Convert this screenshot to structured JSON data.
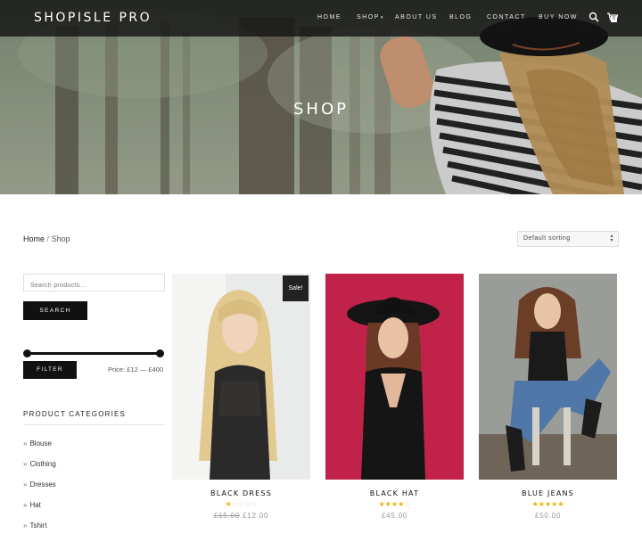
{
  "site": {
    "logo": "SHOPISLE PRO"
  },
  "nav": {
    "items": [
      {
        "label": "HOME"
      },
      {
        "label": "SHOP",
        "caret": "▾"
      },
      {
        "label": "ABOUT US"
      },
      {
        "label": "BLOG"
      },
      {
        "label": "CONTACT"
      },
      {
        "label": "BUY NOW"
      }
    ],
    "search_icon": "search-icon",
    "cart_icon": "cart-icon",
    "cart_count": "0"
  },
  "hero": {
    "title": "SHOP"
  },
  "breadcrumb": {
    "home": "Home",
    "separator": "/",
    "current": "Shop"
  },
  "sort": {
    "selected": "Default sorting"
  },
  "sidebar": {
    "search_placeholder": "Search products…",
    "search_button": "SEARCH",
    "price_slider": {
      "min_fraction": 0,
      "max_fraction": 1
    },
    "filter_button": "FILTER",
    "price_label": "Price: £12 — £400",
    "categories_heading": "PRODUCT CATEGORIES",
    "categories": [
      {
        "label": "Blouse"
      },
      {
        "label": "Clothing"
      },
      {
        "label": "Dresses"
      },
      {
        "label": "Hat"
      },
      {
        "label": "Tshirt"
      }
    ]
  },
  "products": [
    {
      "title": "BLACK DRESS",
      "sale_badge": "Sale!",
      "rating": 1,
      "old_price": "£15.00",
      "price": "£12.00"
    },
    {
      "title": "BLACK HAT",
      "rating": 4,
      "price": "£45.00"
    },
    {
      "title": "BLUE JEANS",
      "rating": 5,
      "price": "£50.00"
    }
  ],
  "colors": {
    "nav_bg": "#141414",
    "button_bg": "#111111",
    "star": "#e7b400",
    "hat_background": "#c0224a"
  }
}
